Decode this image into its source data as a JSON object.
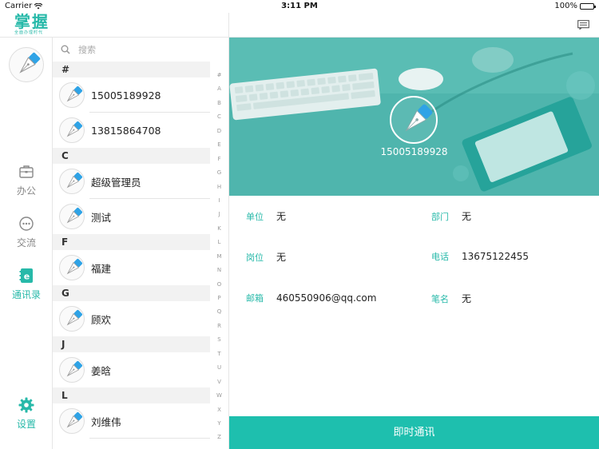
{
  "status_bar": {
    "carrier": "Carrier",
    "time": "3:11 PM",
    "battery": "100%"
  },
  "app": {
    "logo_text": "掌握",
    "logo_subtext": "全面办理时代"
  },
  "left_nav": {
    "items": [
      {
        "label": "办公",
        "icon": "briefcase-icon"
      },
      {
        "label": "交流",
        "icon": "chat-dots-icon"
      },
      {
        "label": "通讯录",
        "icon": "contacts-book-icon",
        "active": true
      }
    ],
    "settings_label": "设置"
  },
  "contacts": {
    "search_placeholder": "搜索",
    "groups": [
      {
        "letter": "#",
        "items": [
          "15005189928",
          "13815864708"
        ]
      },
      {
        "letter": "C",
        "items": [
          "超级管理员",
          "测试"
        ]
      },
      {
        "letter": "F",
        "items": [
          "福建"
        ]
      },
      {
        "letter": "G",
        "items": [
          "顾欢"
        ]
      },
      {
        "letter": "J",
        "items": [
          "姜晗"
        ]
      },
      {
        "letter": "L",
        "items": [
          "刘维伟"
        ]
      }
    ]
  },
  "alpha_index": [
    "#",
    "A",
    "B",
    "C",
    "D",
    "E",
    "F",
    "G",
    "H",
    "I",
    "J",
    "K",
    "L",
    "M",
    "N",
    "O",
    "P",
    "Q",
    "R",
    "S",
    "T",
    "U",
    "V",
    "W",
    "X",
    "Y",
    "Z"
  ],
  "detail": {
    "name": "15005189928",
    "fields": {
      "unit": {
        "label": "单位",
        "value": "无"
      },
      "department": {
        "label": "部门",
        "value": "无"
      },
      "position": {
        "label": "岗位",
        "value": "无"
      },
      "phone": {
        "label": "电话",
        "value": "13675122455"
      },
      "email": {
        "label": "邮箱",
        "value": "460550906@qq.com"
      },
      "pen_name": {
        "label": "笔名",
        "value": "无"
      }
    },
    "action_button": "即时通讯"
  },
  "colors": {
    "accent": "#27b9a9",
    "button": "#1ebfae",
    "banner": "#4fb5ad"
  }
}
